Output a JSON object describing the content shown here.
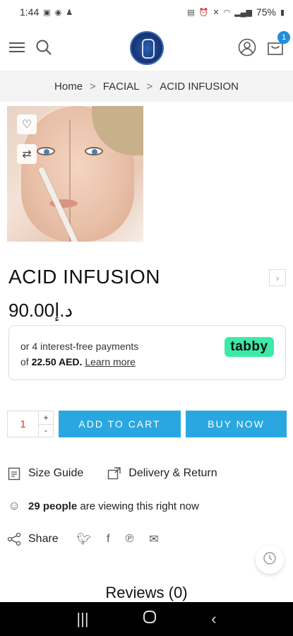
{
  "status_bar": {
    "time": "1:44",
    "battery": "75%"
  },
  "header": {
    "cart_count": "1"
  },
  "breadcrumb": {
    "items": [
      "Home",
      "FACIAL",
      "ACID INFUSION"
    ],
    "separator": ">"
  },
  "product": {
    "title": "ACID INFUSION",
    "price": "90.00د.إ"
  },
  "tabby": {
    "line1": "or 4 interest-free payments",
    "of_text": "of",
    "amount": "22.50 AED.",
    "learn_more": "Learn more",
    "logo": "tabby",
    "brand_color": "#3beaa7"
  },
  "purchase": {
    "quantity": "1",
    "plus": "+",
    "minus": "-",
    "add_to_cart": "ADD TO CART",
    "buy_now": "BUY NOW",
    "button_color": "#2aa7e0"
  },
  "info": {
    "size_guide": "Size Guide",
    "delivery_return": "Delivery & Return",
    "viewers_count": "29 people",
    "viewers_suffix": "are viewing this right now",
    "share": "Share"
  },
  "reviews": {
    "title": "Reviews (0)"
  },
  "icons": {
    "menu": "menu-icon",
    "search": "search-icon",
    "account": "user-icon",
    "cart": "cart-icon",
    "wishlist": "heart-icon",
    "compare": "compare-icon",
    "twitter": "twitter-icon",
    "facebook": "facebook-icon",
    "pinterest": "pinterest-icon",
    "email": "email-icon"
  }
}
